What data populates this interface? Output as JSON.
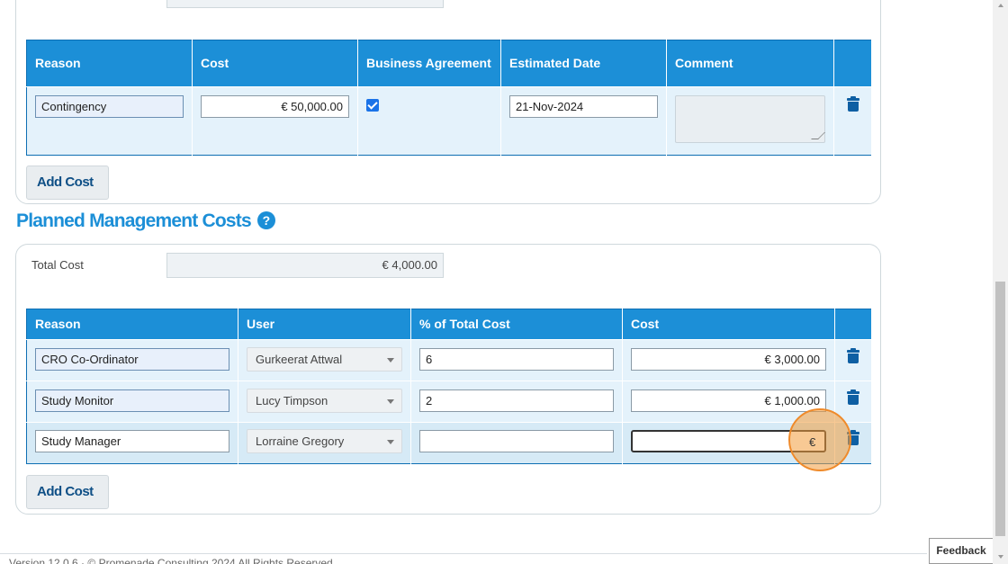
{
  "direct_costs": {
    "headers": [
      "Reason",
      "Cost",
      "Business Agreement",
      "Estimated Date",
      "Comment"
    ],
    "rows": [
      {
        "reason": "Contingency",
        "cost": "€ 50,000.00",
        "business_agreement": true,
        "estimated_date": "21-Nov-2024",
        "comment": ""
      }
    ],
    "add_button": "Add Cost"
  },
  "planned_management": {
    "title": "Planned Management Costs",
    "help_symbol": "?",
    "total_label": "Total Cost",
    "total_value": "€ 4,000.00",
    "headers": [
      "Reason",
      "User",
      "% of Total Cost",
      "Cost"
    ],
    "rows": [
      {
        "reason": "CRO Co-Ordinator",
        "user": "Gurkeerat Attwal",
        "percent": "6",
        "cost": "€ 3,000.00"
      },
      {
        "reason": "Study Monitor",
        "user": "Lucy Timpson",
        "percent": "2",
        "cost": "€ 1,000.00"
      },
      {
        "reason": "Study Manager",
        "user": "Lorraine Gregory",
        "percent": "",
        "cost": "€"
      }
    ],
    "add_button": "Add Cost"
  },
  "feedback_label": "Feedback",
  "footer_text": "Version 12.0.6 · © Promenade Consulting 2024 All Rights Reserved",
  "colors": {
    "accent": "#1c8fd7",
    "header_bg": "#1c8fd7",
    "row_bg": "#e4f2fb",
    "cursor_ring": "#ef8a2a"
  }
}
